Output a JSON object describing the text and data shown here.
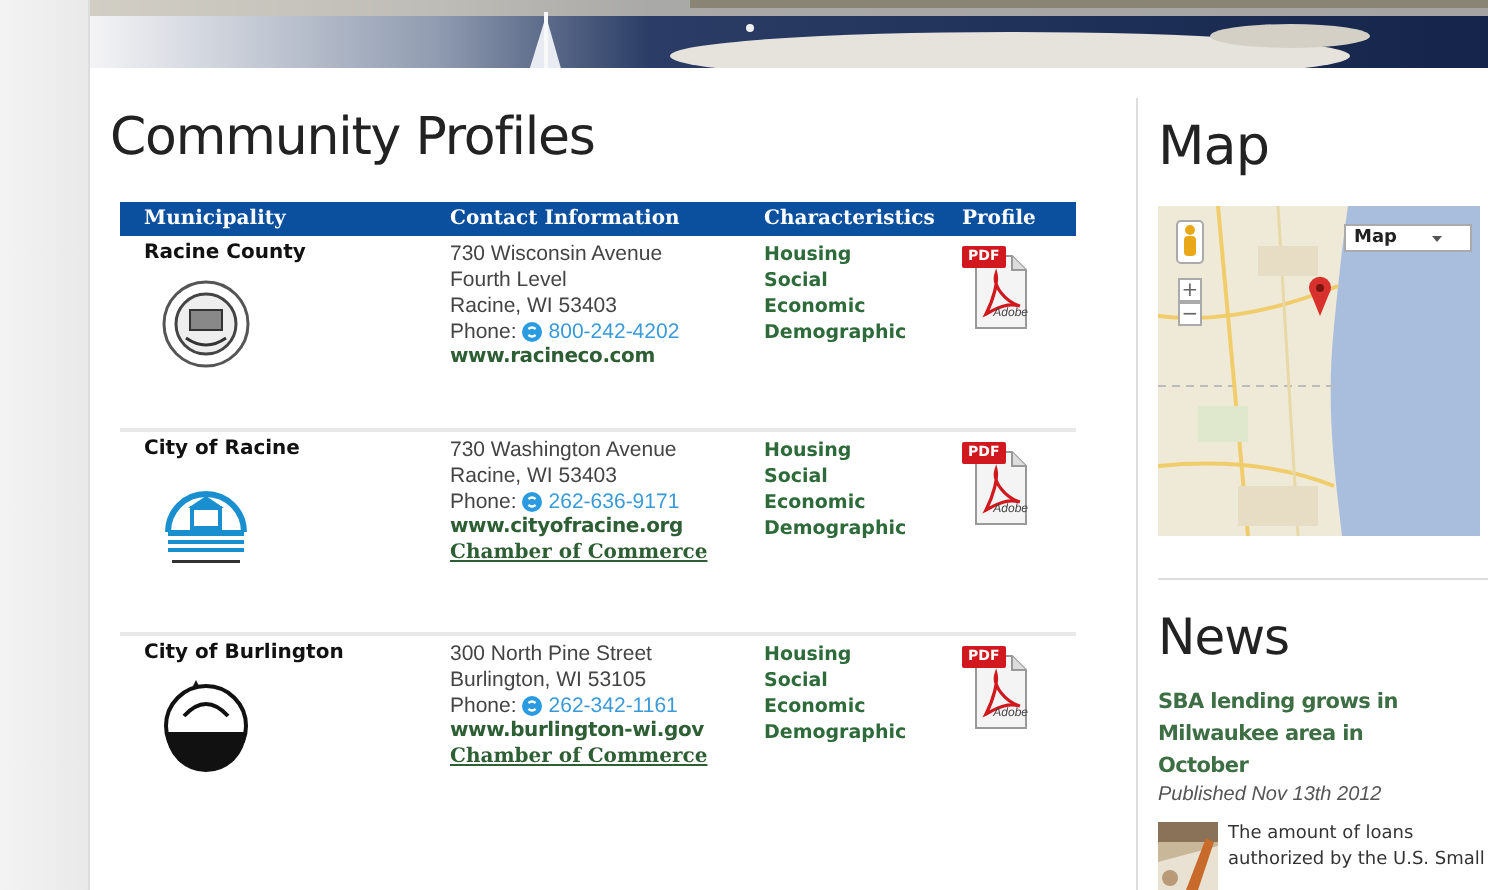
{
  "title": "Community Profiles",
  "table": {
    "columns": [
      "Municipality",
      "Contact Information",
      "Characteristics",
      "Profile"
    ],
    "rows": [
      {
        "municipality": "Racine County",
        "logo": {
          "kind": "seal"
        },
        "address": [
          "730 Wisconsin Avenue",
          "Fourth Level",
          "Racine, WI 53403"
        ],
        "phone_label": "Phone:",
        "phone": "800-242-4202",
        "links": [
          {
            "kind": "website",
            "text": "www.racineco.com"
          }
        ],
        "characteristics": [
          "Housing",
          "Social",
          "Economic",
          "Demographic"
        ],
        "profile": {
          "badge": "PDF",
          "brand": "Adobe"
        }
      },
      {
        "municipality": "City of Racine",
        "logo": {
          "kind": "gazebo"
        },
        "address": [
          "730 Washington Avenue",
          "Racine, WI 53403"
        ],
        "phone_label": "Phone:",
        "phone": "262-636-9171",
        "links": [
          {
            "kind": "website",
            "text": "www.cityofracine.org"
          },
          {
            "kind": "chamber",
            "text": "Chamber of Commerce"
          }
        ],
        "characteristics": [
          "Housing",
          "Social",
          "Economic",
          "Demographic"
        ],
        "profile": {
          "badge": "PDF",
          "brand": "Adobe"
        }
      },
      {
        "municipality": "City of Burlington",
        "logo": {
          "kind": "emblem"
        },
        "address": [
          "300 North Pine Street",
          "Burlington, WI 53105"
        ],
        "phone_label": "Phone:",
        "phone": "262-342-1161",
        "links": [
          {
            "kind": "website",
            "text": "www.burlington-wi.gov"
          },
          {
            "kind": "chamber",
            "text": "Chamber of Commerce"
          }
        ],
        "characteristics": [
          "Housing",
          "Social",
          "Economic",
          "Demographic"
        ],
        "profile": {
          "badge": "PDF",
          "brand": "Adobe"
        }
      }
    ]
  },
  "map": {
    "title": "Map",
    "kind": "picture",
    "type_control": "Map",
    "zoom_in": "+",
    "zoom_out": "−"
  },
  "news": {
    "title": "News",
    "items": [
      {
        "headline": "SBA lending grows in Milwaukee area in October",
        "date": "Published Nov 13th 2012",
        "summary": "The amount of loans authorized by the U.S. Small"
      }
    ]
  }
}
